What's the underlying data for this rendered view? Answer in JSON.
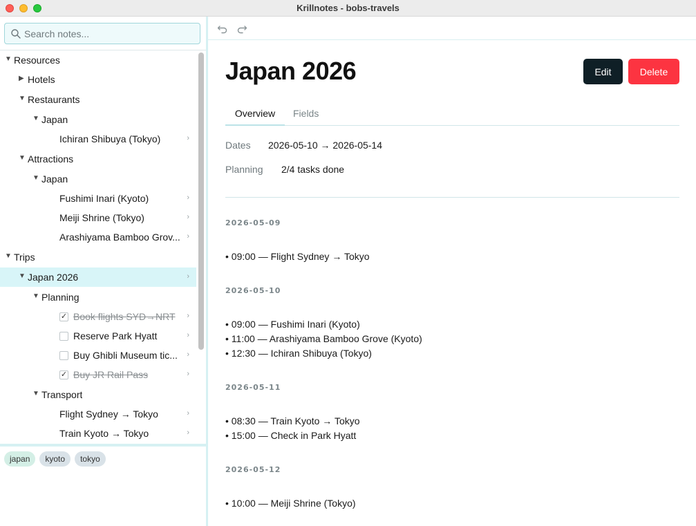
{
  "window": {
    "title": "Krillnotes - bobs-travels"
  },
  "search": {
    "placeholder": "Search notes..."
  },
  "tree": [
    {
      "label": "Resources",
      "caret": "▼",
      "chevron": ""
    },
    {
      "label": "Hotels",
      "caret": "▶",
      "chevron": ""
    },
    {
      "label": "Restaurants",
      "caret": "▼",
      "chevron": ""
    },
    {
      "label": "Japan",
      "caret": "▼",
      "chevron": ""
    },
    {
      "label": "Ichiran Shibuya (Tokyo)",
      "caret": "",
      "chevron": "›"
    },
    {
      "label": "Attractions",
      "caret": "▼",
      "chevron": ""
    },
    {
      "label": "Japan",
      "caret": "▼",
      "chevron": ""
    },
    {
      "label": "Fushimi Inari (Kyoto)",
      "caret": "",
      "chevron": "›"
    },
    {
      "label": "Meiji Shrine (Tokyo)",
      "caret": "",
      "chevron": "›"
    },
    {
      "label": "Arashiyama Bamboo Grov...",
      "caret": "",
      "chevron": "›"
    },
    {
      "label": "Trips",
      "caret": "▼",
      "chevron": ""
    },
    {
      "label": "Japan 2026",
      "caret": "▼",
      "chevron": "›"
    },
    {
      "label": "Planning",
      "caret": "▼",
      "chevron": ""
    },
    {
      "label": "Book flights SYD→NRT",
      "check": "✓",
      "chevron": "›"
    },
    {
      "label": "Reserve Park Hyatt",
      "check": "",
      "chevron": "›"
    },
    {
      "label": "Buy Ghibli Museum tic...",
      "check": "",
      "chevron": "›"
    },
    {
      "label": "Buy JR Rail Pass",
      "check": "✓",
      "chevron": "›"
    },
    {
      "label": "Transport",
      "caret": "▼",
      "chevron": ""
    },
    {
      "label": "Flight Sydney → Tokyo",
      "caret": "",
      "chevron": "›"
    },
    {
      "label": "Train Kyoto → Tokyo",
      "caret": "",
      "chevron": "›"
    }
  ],
  "tags": [
    "japan",
    "kyoto",
    "tokyo"
  ],
  "note": {
    "title": "Japan 2026",
    "edit_label": "Edit",
    "delete_label": "Delete",
    "tabs": [
      "Overview",
      "Fields"
    ],
    "fields": [
      {
        "label": "Dates",
        "value": "2026-05-10 → 2026-05-14"
      },
      {
        "label": "Planning",
        "value": "2/4 tasks done"
      }
    ],
    "days": [
      {
        "date": "2026-05-09",
        "entries": [
          "• 09:00 — Flight Sydney → Tokyo"
        ]
      },
      {
        "date": "2026-05-10",
        "entries": [
          "• 09:00 — Fushimi Inari (Kyoto)",
          "• 11:00 — Arashiyama Bamboo Grove (Kyoto)",
          "• 12:30 — Ichiran Shibuya (Tokyo)"
        ]
      },
      {
        "date": "2026-05-11",
        "entries": [
          "• 08:30 — Train Kyoto → Tokyo",
          "• 15:00 — Check in Park Hyatt"
        ]
      },
      {
        "date": "2026-05-12",
        "entries": [
          "• 10:00 — Meiji Shrine (Tokyo)"
        ]
      }
    ]
  }
}
